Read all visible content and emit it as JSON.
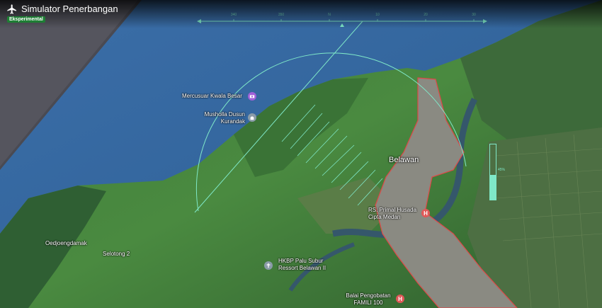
{
  "app": {
    "title": "Simulator Penerbangan",
    "badge": "Eksperimental",
    "accent_color": "#7fe8c8",
    "badge_color": "#1e7e34"
  },
  "hud": {
    "heading_ticks": [
      "340",
      "350",
      "N",
      "10",
      "20",
      "30"
    ],
    "throttle_level": 0.45,
    "throttle_value": "45%"
  },
  "map": {
    "city": "Belawan",
    "places": [
      {
        "name": "Mercusuar Kwala Besar",
        "icon": "camera-icon"
      },
      {
        "name": "Musholla Dusun Kurandak",
        "icon": "mosque-icon"
      },
      {
        "name": "RS. Primal Husada Cipta Medan",
        "icon": "hospital-icon"
      },
      {
        "name": "HKBP Palu Subur Ressort Belawan II",
        "icon": "church-icon"
      },
      {
        "name": "Balai Pengobatan FAMILI 100",
        "icon": "hospital-icon"
      },
      {
        "name": "Oedjoengdamak"
      },
      {
        "name": "Selotong 2"
      }
    ]
  }
}
